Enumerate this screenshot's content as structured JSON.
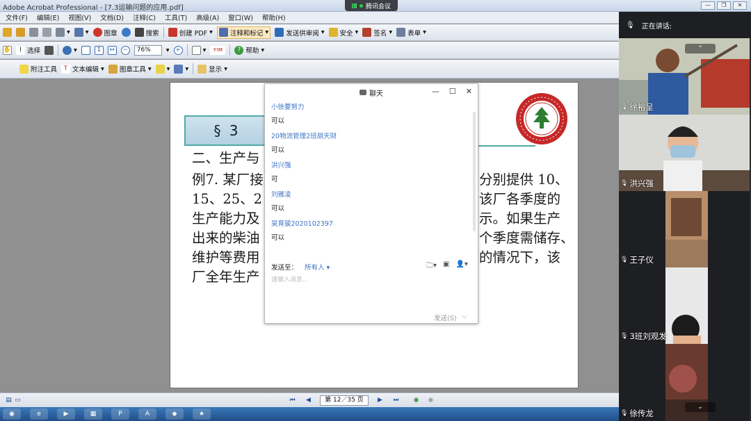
{
  "window": {
    "title": "Adobe Acrobat Professional - [7.3运输问题的应用.pdf]",
    "min": "—",
    "restore": "❐",
    "close": "✕"
  },
  "meeting": {
    "pill_label": "腾讯会议"
  },
  "menu": [
    "文件(F)",
    "编辑(E)",
    "视图(V)",
    "文档(D)",
    "注释(C)",
    "工具(T)",
    "高级(A)",
    "窗口(W)",
    "帮助(H)"
  ],
  "toolbar1": [
    {
      "icon": "open-folder-icon",
      "label": ""
    },
    {
      "icon": "folder-icon",
      "label": ""
    },
    {
      "icon": "save-icon",
      "label": ""
    },
    {
      "icon": "print-icon",
      "label": ""
    },
    {
      "icon": "organizer-icon",
      "label": ""
    },
    {
      "icon": "paperclip-icon",
      "label": ""
    },
    {
      "icon": "stamp-icon",
      "label": "图章"
    },
    {
      "icon": "search-globe-icon",
      "label": ""
    },
    {
      "icon": "binoculars-icon",
      "label": "搜索"
    },
    {
      "icon": "create-pdf-icon",
      "label": "创建 PDF"
    },
    {
      "icon": "comment-markup-icon",
      "label": "注释和标记"
    },
    {
      "icon": "send-review-icon",
      "label": "发送供审阅"
    },
    {
      "icon": "lock-icon",
      "label": "安全"
    },
    {
      "icon": "pen-sign-icon",
      "label": "签名"
    },
    {
      "icon": "form-icon",
      "label": "表单"
    }
  ],
  "toolbar2": {
    "select_label": "选择",
    "zoom_value": "76%",
    "help_label": "帮助"
  },
  "toolbar3": [
    {
      "icon": "sticky-note-icon",
      "label": "附注工具"
    },
    {
      "icon": "text-edit-icon",
      "label": "文本编辑"
    },
    {
      "icon": "stamp-tool-icon",
      "label": "图章工具"
    },
    {
      "icon": "highlighter-icon",
      "label": ""
    },
    {
      "icon": "drawing-icon",
      "label": ""
    },
    {
      "icon": "show-icon",
      "label": "显示"
    }
  ],
  "document": {
    "section_label": "§ 3",
    "lines": [
      {
        "left": "二、生产与",
        "right": ""
      },
      {
        "left": "例7. 某厂接",
        "right": "分别提供 10、"
      },
      {
        "left": "15、25、2",
        "right": "该厂各季度的"
      },
      {
        "left": "生产能力及",
        "right": "示。如果生产"
      },
      {
        "left": "出来的柴油",
        "right": "个季度需储存、"
      },
      {
        "left": "维护等费用",
        "right": "的情况下，该"
      },
      {
        "left": "厂全年生产",
        "right": ""
      }
    ]
  },
  "chat": {
    "title": "聊天",
    "messages": [
      {
        "name": "小徐要努力",
        "text": "可以"
      },
      {
        "name": "20物流管理2班胡天财",
        "text": "可以"
      },
      {
        "name": "洪兴强",
        "text": "可"
      },
      {
        "name": "刘雅凌",
        "text": "可以"
      },
      {
        "name": "吴育骏2020102397",
        "text": "可以"
      }
    ],
    "send_to_label": "发送至：",
    "send_to_value": "所有人 ▾",
    "input_placeholder": "请输入消息...",
    "send_button": "发送(S)"
  },
  "pagenav": {
    "page_text": "第 12／35 页"
  },
  "sidebar": {
    "speaking_label": "正在讲话:",
    "participants": [
      "徐裕呈",
      "洪兴强",
      "王子仪",
      "3班刘观发",
      "徐传龙"
    ]
  }
}
